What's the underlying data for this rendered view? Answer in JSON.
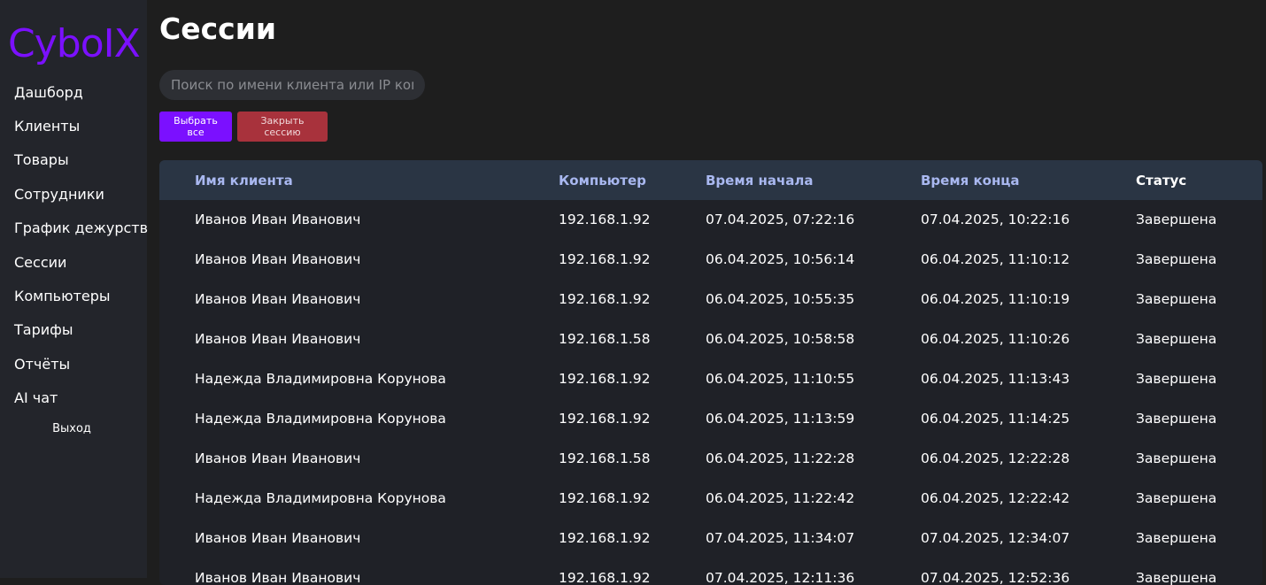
{
  "app": {
    "logo": "CyboIX"
  },
  "sidebar": {
    "items": [
      {
        "label": "Дашборд"
      },
      {
        "label": "Клиенты"
      },
      {
        "label": "Товары"
      },
      {
        "label": "Сотрудники"
      },
      {
        "label": "График дежурств"
      },
      {
        "label": "Сессии"
      },
      {
        "label": "Компьютеры"
      },
      {
        "label": "Тарифы"
      },
      {
        "label": "Отчёты"
      },
      {
        "label": "AI чат"
      }
    ],
    "logout_label": "Выход"
  },
  "main": {
    "title": "Сессии",
    "search_placeholder": "Поиск по имени клиента или IP компьютера",
    "select_all_label": "Выбрать все",
    "close_session_label": "Закрыть сессию"
  },
  "table": {
    "columns": [
      "Имя клиента",
      "Компьютер",
      "Время начала",
      "Время конца",
      "Статус"
    ],
    "rows": [
      [
        "Иванов Иван Иванович",
        "192.168.1.92",
        "07.04.2025, 07:22:16",
        "07.04.2025, 10:22:16",
        "Завершена"
      ],
      [
        "Иванов Иван Иванович",
        "192.168.1.92",
        "06.04.2025, 10:56:14",
        "06.04.2025, 11:10:12",
        "Завершена"
      ],
      [
        "Иванов Иван Иванович",
        "192.168.1.92",
        "06.04.2025, 10:55:35",
        "06.04.2025, 11:10:19",
        "Завершена"
      ],
      [
        "Иванов Иван Иванович",
        "192.168.1.58",
        "06.04.2025, 10:58:58",
        "06.04.2025, 11:10:26",
        "Завершена"
      ],
      [
        "Надежда Владимировна Корунова",
        "192.168.1.92",
        "06.04.2025, 11:10:55",
        "06.04.2025, 11:13:43",
        "Завершена"
      ],
      [
        "Надежда Владимировна Корунова",
        "192.168.1.92",
        "06.04.2025, 11:13:59",
        "06.04.2025, 11:14:25",
        "Завершена"
      ],
      [
        "Иванов Иван Иванович",
        "192.168.1.58",
        "06.04.2025, 11:22:28",
        "06.04.2025, 12:22:28",
        "Завершена"
      ],
      [
        "Надежда Владимировна Корунова",
        "192.168.1.92",
        "06.04.2025, 11:22:42",
        "06.04.2025, 12:22:42",
        "Завершена"
      ],
      [
        "Иванов Иван Иванович",
        "192.168.1.92",
        "07.04.2025, 11:34:07",
        "07.04.2025, 12:34:07",
        "Завершена"
      ],
      [
        "Иванов Иван Иванович",
        "192.168.1.92",
        "07.04.2025, 12:11:36",
        "07.04.2025, 12:52:36",
        "Завершена"
      ]
    ]
  }
}
